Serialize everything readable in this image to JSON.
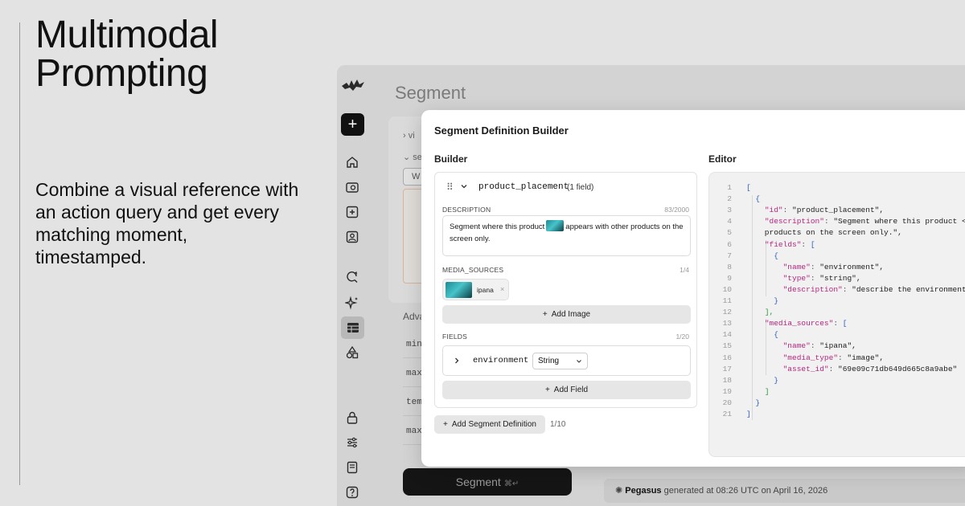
{
  "hero": {
    "title_line1": "Multimodal",
    "title_line2": "Prompting",
    "subtitle": "Combine a visual reference with an action query and get every matching moment, timestamped."
  },
  "app": {
    "background_heading": "Segment",
    "background_rows": [
      "vi",
      "se"
    ],
    "background_input": "W",
    "advanced_label": "Adva",
    "params": [
      "min_",
      "max_",
      "temp",
      "max_"
    ],
    "segment_button": "Segment",
    "segment_shortcut": "⌘↵",
    "status": {
      "brand": "Pegasus",
      "text": "generated at 08:26 UTC on April 16, 2026"
    },
    "rail_icons": [
      "home-icon",
      "video-library-icon",
      "upload-icon",
      "user-id-icon",
      "search-refresh-icon",
      "sparkle-icon",
      "segment-table-icon",
      "shapes-icon",
      "lock-icon",
      "sliders-icon",
      "book-icon",
      "help-icon"
    ]
  },
  "modal": {
    "title": "Segment Definition Builder",
    "builder_label": "Builder",
    "editor_label": "Editor",
    "segment": {
      "name": "product_placement",
      "field_count": "(1 field)",
      "description_label": "DESCRIPTION",
      "description_count": "83/2000",
      "description_before": "Segment where this product",
      "description_after": "appears with other products on the screen only.",
      "media_label": "MEDIA_SOURCES",
      "media_count": "1/4",
      "media_name": "ipana",
      "add_image": "Add Image",
      "fields_label": "FIELDS",
      "fields_count": "1/20",
      "field_name": "environment",
      "field_type": "String",
      "add_field": "Add Field"
    },
    "add_segment": "Add Segment Definition",
    "segment_count": "1/10",
    "code_lines": [
      "[",
      "  {",
      "    \"id\": \"product_placement\",",
      "    \"description\": \"Segment where this product <@",
      "    products on the screen only.\",",
      "    \"fields\": [",
      "      {",
      "        \"name\": \"environment\",",
      "        \"type\": \"string\",",
      "        \"description\": \"describe the environment",
      "      }",
      "    ],",
      "    \"media_sources\": [",
      "      {",
      "        \"name\": \"ipana\",",
      "        \"media_type\": \"image\",",
      "        \"asset_id\": \"69e09c71db649d665c8a9abe\"",
      "      }",
      "    ]",
      "  }",
      "]"
    ],
    "colors": {
      "json_key": "#b5267e",
      "bracket_outer": "#2f5fbf",
      "bracket_inner": "#2c9a3a"
    }
  }
}
